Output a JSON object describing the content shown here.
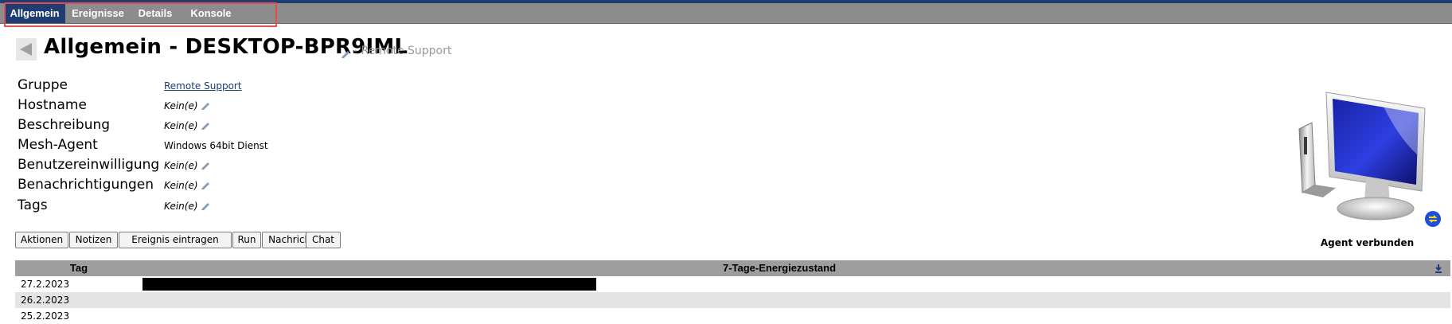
{
  "tabs": [
    {
      "label": "Allgemein",
      "active": true
    },
    {
      "label": "Ereignisse",
      "active": false
    },
    {
      "label": "Details",
      "active": false
    },
    {
      "label": "Konsole",
      "active": false
    }
  ],
  "header": {
    "title": "Allgemein - DESKTOP-BPR9IML",
    "subtitle": "- Remote Support"
  },
  "properties": [
    {
      "label": "Gruppe",
      "value": "Remote Support",
      "style": "link"
    },
    {
      "label": "Hostname",
      "value": "Kein(e)",
      "style": "italic"
    },
    {
      "label": "Beschreibung",
      "value": "Kein(e)",
      "style": "italic"
    },
    {
      "label": "Mesh-Agent",
      "value": "Windows 64bit Dienst",
      "style": "plain"
    },
    {
      "label": "Benutzereinwilligung",
      "value": "Kein(e)",
      "style": "italic"
    },
    {
      "label": "Benachrichtigungen",
      "value": "Kein(e)",
      "style": "italic"
    },
    {
      "label": "Tags",
      "value": "Kein(e)",
      "style": "italic"
    }
  ],
  "actions": [
    "Aktionen",
    "Notizen",
    "Ereignis eintragen",
    "Run",
    "Nachricht",
    "Chat"
  ],
  "agent": {
    "status": "Agent verbunden",
    "icon": "desktop-computer-icon"
  },
  "power_table": {
    "headers": {
      "day": "Tag",
      "state": "7-Tage-Energiezustand"
    },
    "rows": [
      {
        "date": "27.2.2023",
        "has_bar": true
      },
      {
        "date": "26.2.2023",
        "has_bar": false
      },
      {
        "date": "25.2.2023",
        "has_bar": false
      }
    ]
  },
  "colors": {
    "accent": "#1f3d73",
    "tabbar": "#8c8c8c",
    "highlight": "#e05050"
  }
}
